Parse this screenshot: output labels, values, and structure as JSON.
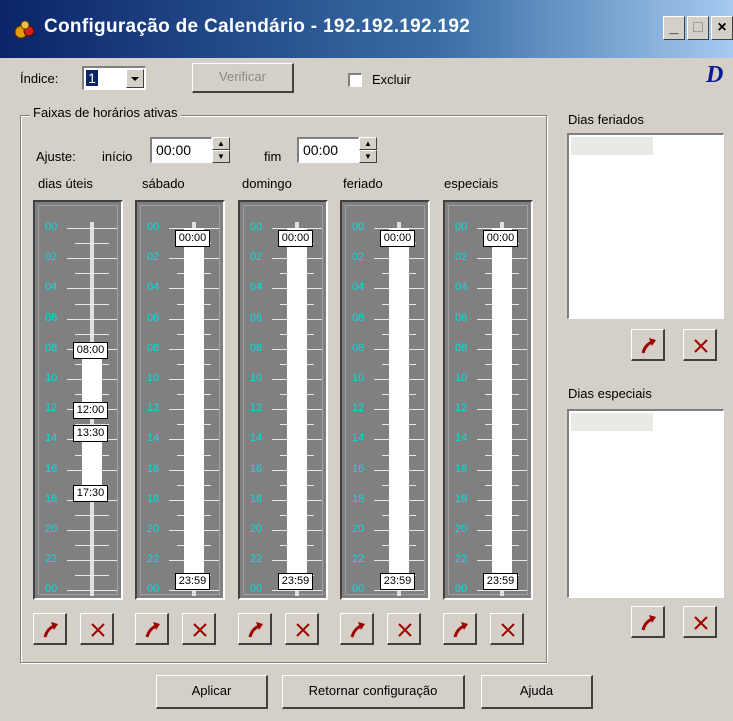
{
  "window": {
    "title": "Configuração de Calendário - 192.192.192.192",
    "minimize_label": "_",
    "maximize_label": "□",
    "close_label": "×"
  },
  "toolbar": {
    "indice_label": "Índice:",
    "indice_value": "1",
    "verificar_label": "Verificar",
    "excluir_label": "Excluir",
    "excluir_checked": false,
    "logo_letter": "D"
  },
  "group": {
    "title": "Faixas de horários ativas",
    "ajuste_label": "Ajuste:",
    "inicio_label": "início",
    "inicio_value": "00:00",
    "fim_label": "fim",
    "fim_value": "00:00"
  },
  "hour_labels": [
    "00",
    "02",
    "04",
    "06",
    "08",
    "10",
    "12",
    "14",
    "16",
    "18",
    "20",
    "22",
    "00"
  ],
  "columns": [
    {
      "id": "dias-uteis",
      "label": "dias úteis",
      "ranges": [
        {
          "start": "08:00",
          "end": "12:00"
        },
        {
          "start": "13:30",
          "end": "17:30"
        }
      ]
    },
    {
      "id": "sabado",
      "label": "sábado",
      "ranges": [
        {
          "start": "00:00",
          "end": "23:59"
        }
      ]
    },
    {
      "id": "domingo",
      "label": "domingo",
      "ranges": [
        {
          "start": "00:00",
          "end": "23:59"
        }
      ]
    },
    {
      "id": "feriado",
      "label": "feriado",
      "ranges": [
        {
          "start": "00:00",
          "end": "23:59"
        }
      ]
    },
    {
      "id": "especiais",
      "label": "especiais",
      "ranges": [
        {
          "start": "00:00",
          "end": "23:59"
        }
      ]
    }
  ],
  "side": {
    "feriados_label": "Dias feriados",
    "especiais_label": "Dias especiais"
  },
  "footer": {
    "aplicar_label": "Aplicar",
    "retornar_label": "Retornar configuração",
    "ajuda_label": "Ajuda"
  },
  "icons": {
    "apply": "red-curved-arrow-icon",
    "delete": "red-x-icon"
  },
  "colors": {
    "title_start": "#0a246a",
    "title_end": "#a6caf0",
    "hour_label": "#00e0e0",
    "icon_red": "#a00000"
  }
}
